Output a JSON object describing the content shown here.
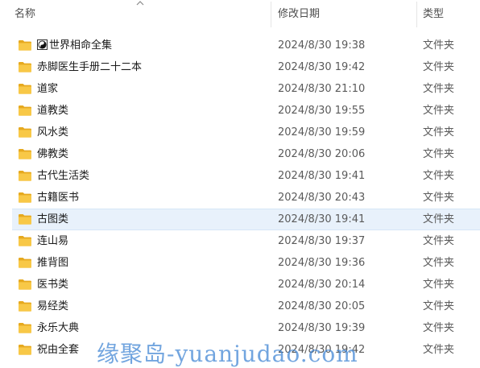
{
  "columns": {
    "name": "名称",
    "date": "修改日期",
    "type": "类型"
  },
  "rows": [
    {
      "name": "世界相命全集",
      "date": "2024/8/30 19:38",
      "type": "文件夹",
      "prefix_icon": "yin-yang-icon"
    },
    {
      "name": "赤脚医生手册二十二本",
      "date": "2024/8/30 19:42",
      "type": "文件夹"
    },
    {
      "name": "道家",
      "date": "2024/8/30 21:10",
      "type": "文件夹"
    },
    {
      "name": "道教类",
      "date": "2024/8/30 19:55",
      "type": "文件夹"
    },
    {
      "name": "风水类",
      "date": "2024/8/30 19:59",
      "type": "文件夹"
    },
    {
      "name": "佛教类",
      "date": "2024/8/30 20:06",
      "type": "文件夹"
    },
    {
      "name": "古代生活类",
      "date": "2024/8/30 19:41",
      "type": "文件夹"
    },
    {
      "name": "古籍医书",
      "date": "2024/8/30 20:43",
      "type": "文件夹"
    },
    {
      "name": "古图类",
      "date": "2024/8/30 19:41",
      "type": "文件夹",
      "selected": true
    },
    {
      "name": "连山易",
      "date": "2024/8/30 19:37",
      "type": "文件夹"
    },
    {
      "name": "推背图",
      "date": "2024/8/30 19:36",
      "type": "文件夹"
    },
    {
      "name": "医书类",
      "date": "2024/8/30 20:14",
      "type": "文件夹"
    },
    {
      "name": "易经类",
      "date": "2024/8/30 20:05",
      "type": "文件夹"
    },
    {
      "name": "永乐大典",
      "date": "2024/8/30 19:39",
      "type": "文件夹"
    },
    {
      "name": "祝由全套",
      "date": "2024/8/30 19:42",
      "type": "文件夹"
    }
  ],
  "watermark": "缘聚岛-yuanjudao.com",
  "colors": {
    "folder": "#f8c847",
    "folder_dark": "#e6a91f",
    "selected_bg": "#e8f1fb",
    "watermark": "#3c82d2"
  }
}
